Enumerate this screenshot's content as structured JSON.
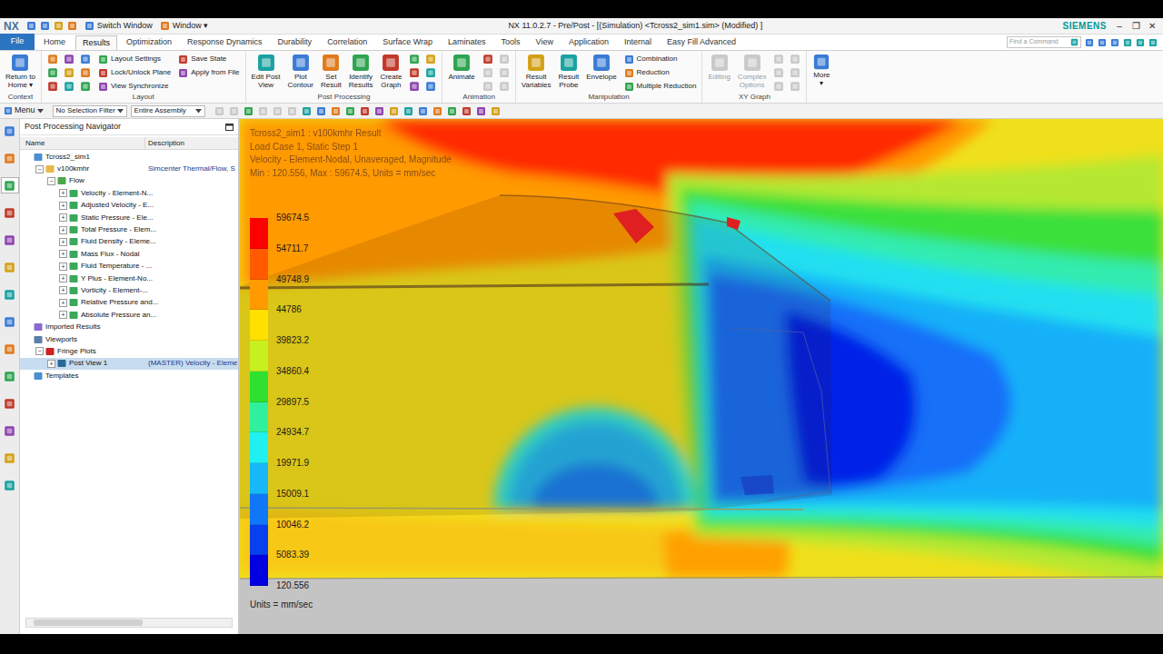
{
  "titlebar": {
    "logo": "NX",
    "quick_access": [
      {
        "label": "Switch Window"
      },
      {
        "label": "Window ▾"
      }
    ],
    "title": "NX 11.0.2.7 - Pre/Post - [(Simulation) <Tcross2_sim1.sim> (Modified) ]",
    "brand": "SIEMENS",
    "controls": [
      "–",
      "❐",
      "✕"
    ]
  },
  "tabs": [
    {
      "label": "File",
      "selected": false,
      "kind": "file"
    },
    {
      "label": "Home",
      "selected": false,
      "kind": "tab"
    },
    {
      "label": "Results",
      "selected": true,
      "kind": "tab"
    },
    {
      "label": "Optimization",
      "selected": false,
      "kind": "tab"
    },
    {
      "label": "Response Dynamics",
      "selected": false,
      "kind": "tab"
    },
    {
      "label": "Durability",
      "selected": false,
      "kind": "tab"
    },
    {
      "label": "Correlation",
      "selected": false,
      "kind": "tab"
    },
    {
      "label": "Surface Wrap",
      "selected": false,
      "kind": "tab"
    },
    {
      "label": "Laminates",
      "selected": false,
      "kind": "tab"
    },
    {
      "label": "Tools",
      "selected": false,
      "kind": "tab"
    },
    {
      "label": "View",
      "selected": false,
      "kind": "tab"
    },
    {
      "label": "Application",
      "selected": false,
      "kind": "tab"
    },
    {
      "label": "Internal",
      "selected": false,
      "kind": "tab"
    },
    {
      "label": "Easy Fill Advanced",
      "selected": false,
      "kind": "tab"
    }
  ],
  "search": {
    "placeholder": "Find a Command"
  },
  "ribbon": {
    "groups": [
      {
        "label": "Context",
        "items": [
          {
            "kind": "large",
            "lines": [
              "Return to",
              "Home ▾"
            ],
            "disabled": false
          }
        ]
      },
      {
        "label": "Layout",
        "items": [
          {
            "kind": "icon-grid",
            "icons": [
              {
                "disabled": false
              },
              {
                "disabled": false
              },
              {
                "disabled": false
              },
              {
                "disabled": false
              },
              {
                "disabled": false
              },
              {
                "disabled": false
              },
              {
                "disabled": false
              },
              {
                "disabled": false
              },
              {
                "disabled": false
              }
            ]
          },
          {
            "kind": "small-column",
            "entries": [
              {
                "label": "Layout Settings",
                "disabled": false
              },
              {
                "label": "Lock/Unlock Plane",
                "disabled": false
              },
              {
                "label": "View Synchronize",
                "disabled": false
              }
            ]
          },
          {
            "kind": "small-column",
            "entries": [
              {
                "label": "Save State",
                "disabled": false
              },
              {
                "label": "Apply from File",
                "disabled": false
              }
            ]
          }
        ]
      },
      {
        "label": "Post Processing",
        "items": [
          {
            "kind": "large",
            "lines": [
              "Edit Post",
              "View"
            ],
            "disabled": false
          },
          {
            "kind": "large",
            "lines": [
              "Plot",
              "Contour"
            ],
            "disabled": false
          },
          {
            "kind": "large",
            "lines": [
              "Set",
              "Result"
            ],
            "disabled": false
          },
          {
            "kind": "large",
            "lines": [
              "Identify",
              "Results"
            ],
            "disabled": false
          },
          {
            "kind": "large",
            "lines": [
              "Create",
              "Graph"
            ],
            "disabled": false
          },
          {
            "kind": "icon-grid",
            "icons": [
              {
                "disabled": false
              },
              {
                "disabled": false
              },
              {
                "disabled": false
              },
              {
                "disabled": false
              },
              {
                "disabled": false
              },
              {
                "disabled": false
              }
            ]
          }
        ]
      },
      {
        "label": "Animation",
        "items": [
          {
            "kind": "large",
            "lines": [
              "Animate"
            ],
            "disabled": false
          },
          {
            "kind": "icon-grid",
            "icons": [
              {
                "disabled": false
              },
              {
                "disabled": true
              },
              {
                "disabled": true
              },
              {
                "disabled": true
              },
              {
                "disabled": true
              },
              {
                "disabled": true
              }
            ]
          }
        ]
      },
      {
        "label": "Manipulation",
        "items": [
          {
            "kind": "large",
            "lines": [
              "Result",
              "Variables"
            ],
            "disabled": false
          },
          {
            "kind": "large",
            "lines": [
              "Result",
              "Probe"
            ],
            "disabled": false
          },
          {
            "kind": "large",
            "lines": [
              "Envelope"
            ],
            "disabled": false
          },
          {
            "kind": "small-column",
            "entries": [
              {
                "label": "Combination",
                "disabled": false
              },
              {
                "label": "Reduction",
                "disabled": false
              },
              {
                "label": "Multiple Reduction",
                "disabled": false
              }
            ]
          }
        ]
      },
      {
        "label": "XY Graph",
        "items": [
          {
            "kind": "large",
            "lines": [
              "Editing"
            ],
            "disabled": true
          },
          {
            "kind": "large",
            "lines": [
              "Complex",
              "Options"
            ],
            "disabled": true
          },
          {
            "kind": "icon-grid",
            "icons": [
              {
                "disabled": true
              },
              {
                "disabled": true
              },
              {
                "disabled": true
              },
              {
                "disabled": true
              },
              {
                "disabled": true
              },
              {
                "disabled": true
              }
            ]
          }
        ]
      }
    ],
    "more": {
      "label": "More",
      "arrow": "▾"
    }
  },
  "toolbar": {
    "menu": "Menu",
    "dropdowns": [
      "No Selection Filter",
      "Entire Assembly"
    ],
    "icons": [
      {
        "disabled": true
      },
      {
        "disabled": true
      },
      {
        "disabled": false
      },
      {
        "disabled": true
      },
      {
        "disabled": true
      },
      {
        "disabled": true
      },
      {
        "disabled": false
      },
      {
        "disabled": false
      },
      {
        "disabled": false
      },
      {
        "disabled": false
      },
      {
        "disabled": false
      },
      {
        "disabled": false
      },
      {
        "disabled": false
      },
      {
        "disabled": false
      },
      {
        "disabled": false
      },
      {
        "disabled": false
      },
      {
        "disabled": false
      },
      {
        "disabled": false
      },
      {
        "disabled": false
      },
      {
        "disabled": false
      }
    ]
  },
  "resource_bar": {
    "tabs": [
      {
        "selected": false
      },
      {
        "selected": false
      },
      {
        "selected": true
      },
      {
        "selected": false
      },
      {
        "selected": false
      },
      {
        "selected": false
      },
      {
        "selected": false
      },
      {
        "selected": false
      },
      {
        "selected": false
      },
      {
        "selected": false
      },
      {
        "selected": false
      },
      {
        "selected": false
      },
      {
        "selected": false
      },
      {
        "selected": false
      }
    ]
  },
  "navigator": {
    "title": "Post Processing Navigator",
    "columns": [
      "Name",
      "Description"
    ],
    "rows": [
      {
        "name": "Tcross2_sim1",
        "description": "",
        "level": 0,
        "expander": "",
        "kind": "sim",
        "selected": false
      },
      {
        "name": "v100kmhr",
        "description": "Simcenter Thermal/Flow, S",
        "level": 1,
        "expander": "−",
        "kind": "folder",
        "selected": false
      },
      {
        "name": "Flow",
        "description": "",
        "level": 2,
        "expander": "−",
        "kind": "flow",
        "selected": false
      },
      {
        "name": "Velocity - Element-N...",
        "description": "",
        "level": 3,
        "expander": "+",
        "kind": "result",
        "selected": false
      },
      {
        "name": "Adjusted Velocity - E...",
        "description": "",
        "level": 3,
        "expander": "+",
        "kind": "result",
        "selected": false
      },
      {
        "name": "Static Pressure - Ele...",
        "description": "",
        "level": 3,
        "expander": "+",
        "kind": "result",
        "selected": false
      },
      {
        "name": "Total Pressure - Elem...",
        "description": "",
        "level": 3,
        "expander": "+",
        "kind": "result",
        "selected": false
      },
      {
        "name": "Fluid Density - Eleme...",
        "description": "",
        "level": 3,
        "expander": "+",
        "kind": "result",
        "selected": false
      },
      {
        "name": "Mass Flux - Nodal",
        "description": "",
        "level": 3,
        "expander": "+",
        "kind": "result",
        "selected": false
      },
      {
        "name": "Fluid Temperature - ...",
        "description": "",
        "level": 3,
        "expander": "+",
        "kind": "result",
        "selected": false
      },
      {
        "name": "Y Plus - Element-No...",
        "description": "",
        "level": 3,
        "expander": "+",
        "kind": "result",
        "selected": false
      },
      {
        "name": "Vorticity - Element-...",
        "description": "",
        "level": 3,
        "expander": "+",
        "kind": "result",
        "selected": false
      },
      {
        "name": "Relative Pressure and...",
        "description": "",
        "level": 3,
        "expander": "+",
        "kind": "result",
        "selected": false
      },
      {
        "name": "Absolute Pressure an...",
        "description": "",
        "level": 3,
        "expander": "+",
        "kind": "result",
        "selected": false
      },
      {
        "name": "Imported Results",
        "description": "",
        "level": 0,
        "expander": "",
        "kind": "imported",
        "selected": false
      },
      {
        "name": "Viewports",
        "description": "",
        "level": 0,
        "expander": "",
        "kind": "viewports",
        "selected": false
      },
      {
        "name": "Fringe Plots",
        "description": "",
        "level": 1,
        "expander": "−",
        "kind": "fringe",
        "selected": false
      },
      {
        "name": "Post View 1",
        "description": "(MASTER) Velocity - Eleme",
        "level": 2,
        "expander": "+",
        "kind": "postview",
        "selected": true
      },
      {
        "name": "Templates",
        "description": "",
        "level": 0,
        "expander": "",
        "kind": "templates",
        "selected": false
      }
    ]
  },
  "viewport": {
    "info": [
      "Tcross2_sim1 : v100kmhr Result",
      "Load Case 1, Static Step 1",
      "Velocity - Element-Nodal, Unaveraged, Magnitude",
      "Min : 120.556, Max : 59674.5, Units = mm/sec"
    ],
    "legend": {
      "values": [
        "59674.5",
        "54711.7",
        "49748.9",
        "44786",
        "39823.2",
        "34860.4",
        "29897.5",
        "24934.7",
        "19971.9",
        "15009.1",
        "10046.2",
        "5083.39",
        "120.556"
      ],
      "bands": [
        {
          "color": "#ff0000"
        },
        {
          "color": "#ff5a00"
        },
        {
          "color": "#ff9a00"
        },
        {
          "color": "#ffe000"
        },
        {
          "color": "#c8f020"
        },
        {
          "color": "#30e030"
        },
        {
          "color": "#30f0a0"
        },
        {
          "color": "#20f0f0"
        },
        {
          "color": "#18b8f8"
        },
        {
          "color": "#1078f8"
        },
        {
          "color": "#0840f0"
        },
        {
          "color": "#0000e0"
        }
      ]
    },
    "units": "Units = mm/sec"
  }
}
